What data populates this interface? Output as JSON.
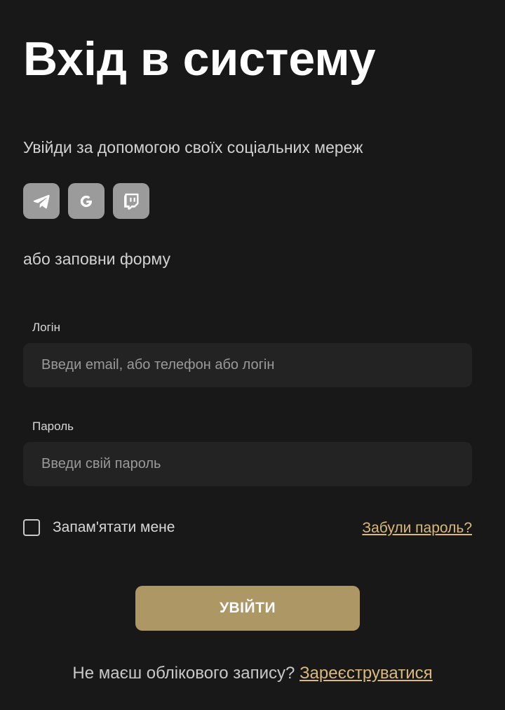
{
  "page": {
    "title": "Вхід в систему"
  },
  "social": {
    "heading": "Увійди за допомогою своїх соціальних мереж",
    "buttons": [
      {
        "icon": "telegram-icon"
      },
      {
        "icon": "google-icon"
      },
      {
        "icon": "twitch-icon"
      }
    ],
    "or_text": "або заповни форму"
  },
  "form": {
    "login": {
      "label": "Логін",
      "placeholder": "Введи email, або телефон або логін",
      "value": ""
    },
    "password": {
      "label": "Пароль",
      "placeholder": "Введи свій пароль",
      "value": ""
    },
    "remember_label": "Запам'ятати мене",
    "remember_checked": false,
    "forgot_link": "Забули пароль?",
    "submit_label": "УВІЙТИ"
  },
  "register": {
    "question": "Не маєш облікового запису?",
    "link": "Зареєструватися"
  },
  "colors": {
    "background": "#181818",
    "input_background": "#232323",
    "social_button": "#9b9b9b",
    "accent_button": "#ad9764",
    "link": "#d9b97c"
  }
}
